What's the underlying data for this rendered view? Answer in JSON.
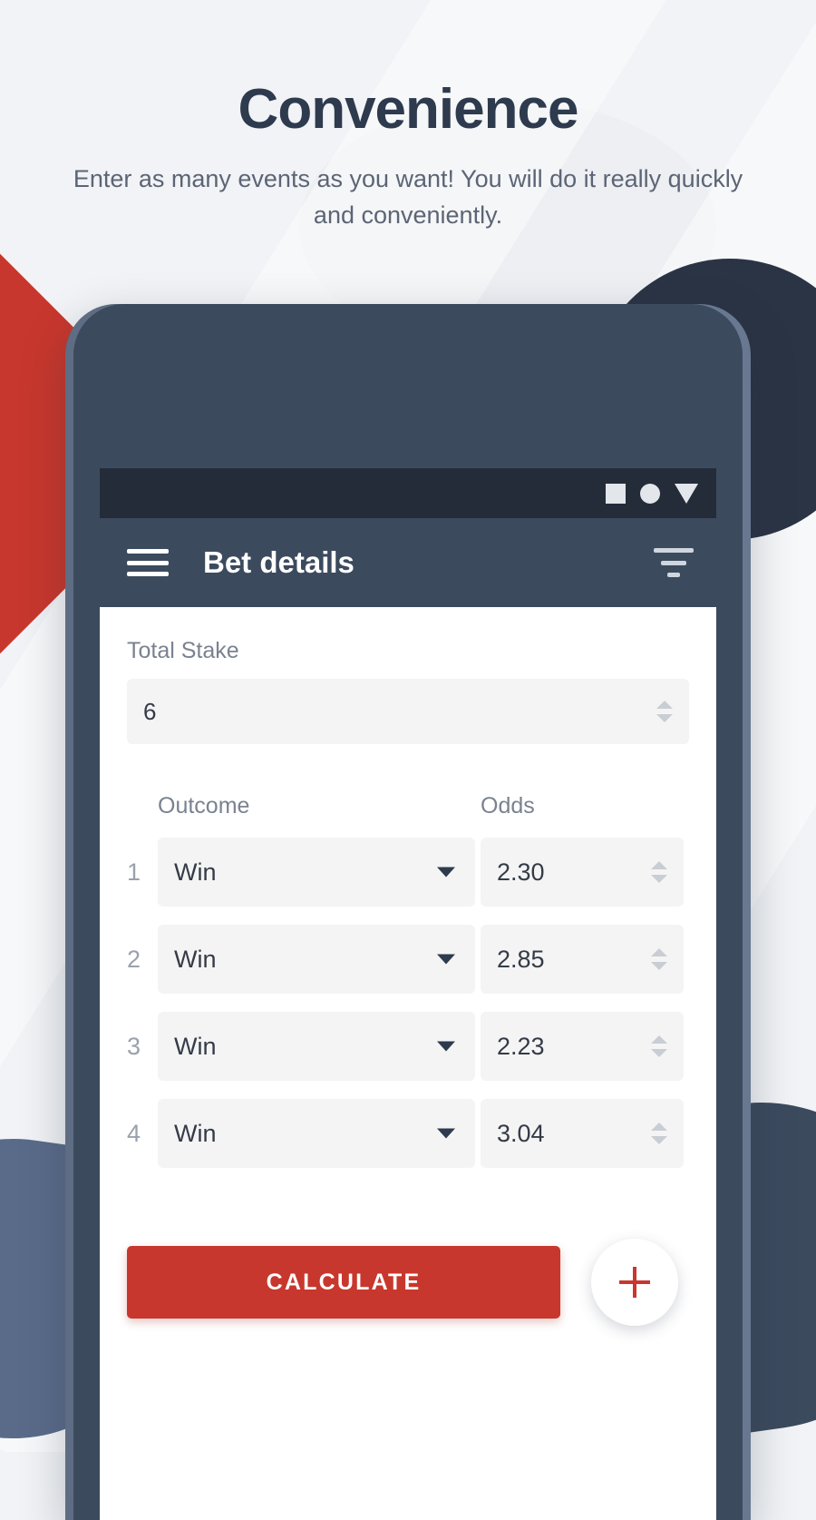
{
  "header": {
    "title": "Convenience",
    "subtitle": "Enter as many events as you want! You will do it really quickly and conveniently."
  },
  "colors": {
    "accent_red": "#C8372D",
    "phone_frame": "#3C4A5E",
    "status_bar": "#242C3A",
    "navy_circle": "#2B3445",
    "blue_shape": "#5A6B8A",
    "page_background": "#F1F3F6",
    "input_background": "#F4F4F4",
    "title_text": "#2E3A4D",
    "muted_text": "#7A8290"
  },
  "status_bar": {
    "icons": [
      "square-icon",
      "circle-icon",
      "triangle-down-icon"
    ]
  },
  "app_bar": {
    "menu_icon": "hamburger-menu-icon",
    "title": "Bet details",
    "action_icon": "filter-icon"
  },
  "screen": {
    "total_stake": {
      "label": "Total Stake",
      "value": "6",
      "spinner_icon": "stepper-updown-icon"
    },
    "table": {
      "headers": [
        "Outcome",
        "Odds"
      ],
      "rows": [
        {
          "index": "1",
          "outcome": "Win",
          "odds": "2.30"
        },
        {
          "index": "2",
          "outcome": "Win",
          "odds": "2.85"
        },
        {
          "index": "3",
          "outcome": "Win",
          "odds": "2.23"
        },
        {
          "index": "4",
          "outcome": "Win",
          "odds": "3.04"
        }
      ]
    },
    "actions": {
      "calculate_label": "CALCULATE",
      "add_icon": "plus-icon"
    }
  }
}
